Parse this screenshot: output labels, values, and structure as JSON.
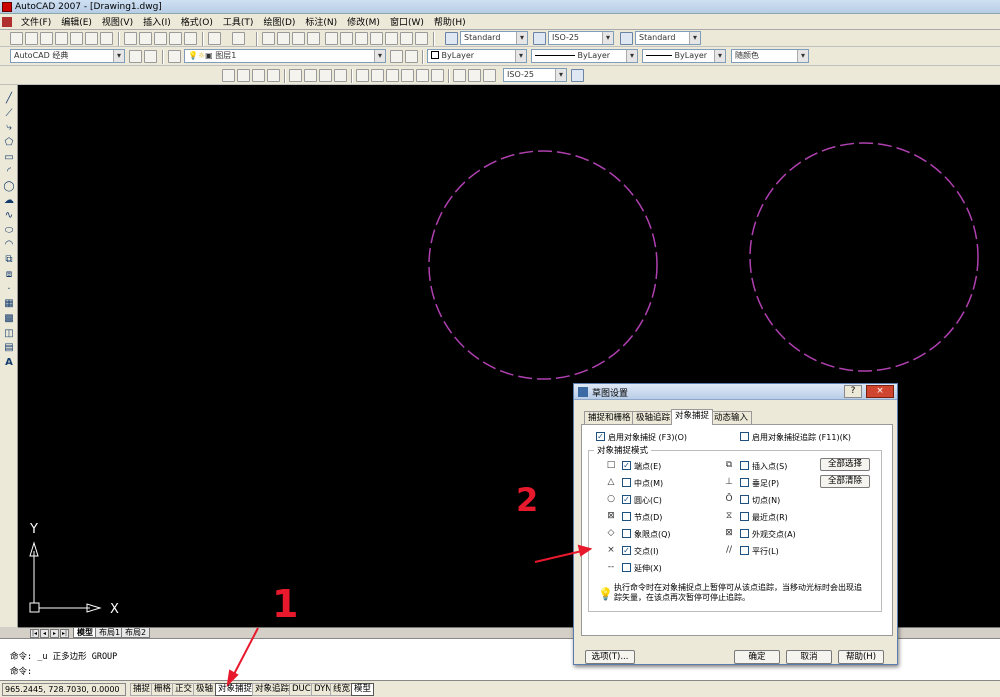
{
  "titlebar": {
    "title": "AutoCAD 2007 - [Drawing1.dwg]"
  },
  "menubar": {
    "items": [
      "文件(F)",
      "编辑(E)",
      "视图(V)",
      "插入(I)",
      "格式(O)",
      "工具(T)",
      "绘图(D)",
      "标注(N)",
      "修改(M)",
      "窗口(W)",
      "帮助(H)"
    ]
  },
  "toolbars": {
    "text_style": "Standard",
    "dim_style": "ISO-25",
    "table_style": "Standard",
    "workspace": "AutoCAD 经典",
    "layer": "图层1",
    "color": "ByLayer",
    "linetype": "ByLayer",
    "lineweight": "ByLayer",
    "plot_style": "随颜色",
    "dim_style_2": "ISO-25"
  },
  "canvas": {
    "background": "#000000",
    "circle_color": "#b040b0",
    "ucs_x": "X",
    "ucs_y": "Y"
  },
  "layout_tabs": {
    "model": "模型",
    "layout1": "布局1",
    "layout2": "布局2"
  },
  "command": {
    "line1": "命令: _u 正多边形 GROUP",
    "line2": "命令:"
  },
  "status": {
    "coords": "965.2445,  728.7030, 0.0000",
    "buttons": [
      "捕捉",
      "栅格",
      "正交",
      "极轴",
      "对象捕捉",
      "对象追踪",
      "DUCS",
      "DYN",
      "线宽",
      "模型"
    ]
  },
  "dialog": {
    "title": "草图设置",
    "help_btn": "?",
    "close_btn": "×",
    "tabs": [
      "捕捉和栅格",
      "极轴追踪",
      "对象捕捉",
      "动态输入"
    ],
    "enable_osnap": "启用对象捕捉 (F3)(O)",
    "enable_tracking": "启用对象捕捉追踪 (F11)(K)",
    "group_title": "对象捕捉模式",
    "left_modes": [
      {
        "label": "端点(E)",
        "checked": "✓",
        "symbol": "□"
      },
      {
        "label": "中点(M)",
        "checked": "",
        "symbol": "△"
      },
      {
        "label": "圆心(C)",
        "checked": "✓",
        "symbol": "○"
      },
      {
        "label": "节点(D)",
        "checked": "",
        "symbol": "⊠"
      },
      {
        "label": "象限点(Q)",
        "checked": "",
        "symbol": "◇"
      },
      {
        "label": "交点(I)",
        "checked": "✓",
        "symbol": "×"
      },
      {
        "label": "延伸(X)",
        "checked": "",
        "symbol": "--"
      }
    ],
    "right_modes": [
      {
        "label": "插入点(S)",
        "checked": "",
        "symbol": "⧉"
      },
      {
        "label": "垂足(P)",
        "checked": "",
        "symbol": "⊥"
      },
      {
        "label": "切点(N)",
        "checked": "",
        "symbol": "Ō"
      },
      {
        "label": "最近点(R)",
        "checked": "",
        "symbol": "⧖"
      },
      {
        "label": "外观交点(A)",
        "checked": "",
        "symbol": "⊠"
      },
      {
        "label": "平行(L)",
        "checked": "",
        "symbol": "//"
      }
    ],
    "select_all": "全部选择",
    "clear_all": "全部清除",
    "tip": "执行命令时在对象捕捉点上暂停可从该点追踪，当移动光标时会出现追踪矢量，在该点再次暂停可停止追踪。",
    "options_btn": "选项(T)...",
    "ok_btn": "确定",
    "cancel_btn": "取消",
    "help_btn2": "帮助(H)"
  },
  "annotations": {
    "label1": "1",
    "label2": "2",
    "color": "#e8192c"
  }
}
